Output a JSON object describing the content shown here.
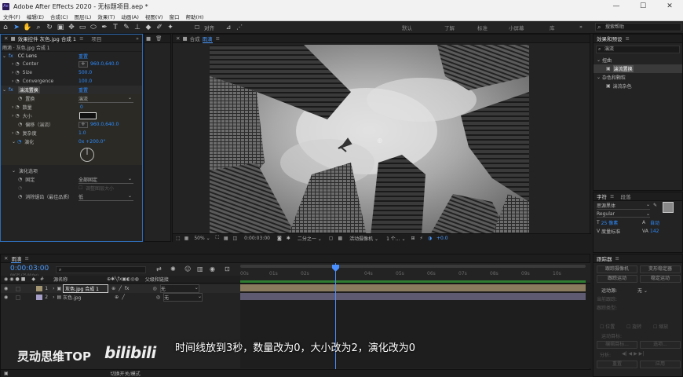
{
  "app": {
    "title": "Adobe After Effects 2020 - 无标题项目.aep *",
    "logo": "Ae"
  },
  "window": {
    "minimize": "—",
    "maximize": "☐",
    "close": "✕"
  },
  "menu": [
    "文件(F)",
    "编辑(E)",
    "合成(C)",
    "图层(L)",
    "效果(T)",
    "动画(A)",
    "视图(V)",
    "窗口",
    "帮助(H)"
  ],
  "toolbar": {
    "align": "对齐",
    "workspaces": [
      "默认",
      "了解",
      "标准",
      "小屏幕",
      "库"
    ],
    "search_placeholder": "搜索帮助"
  },
  "effects_panel": {
    "tab_label": "效果控件 灰色.jpg 合成 1",
    "tab2": "项目",
    "menu_icon": "≡",
    "path": "雨滴 · 灰色.jpg 合成 1",
    "cc_lens": {
      "fx": "fx",
      "name": "CC Lens",
      "reset": "重置",
      "params": [
        {
          "name": "Center",
          "value": "960.0,640.0"
        },
        {
          "name": "Size",
          "value": "500.0"
        },
        {
          "name": "Convergence",
          "value": "100.0"
        }
      ]
    },
    "displace": {
      "fx": "fx",
      "name": "湍流置换",
      "reset": "重置",
      "params": [
        {
          "name": "置换",
          "value": "湍流"
        },
        {
          "name": "数量",
          "value": "0"
        },
        {
          "name": "大小",
          "value": ""
        },
        {
          "name": "偏移（湍流）",
          "value": "960.0,640.0"
        },
        {
          "name": "复杂度",
          "value": "1.0"
        },
        {
          "name": "演化",
          "value": "0x +200.0°"
        }
      ],
      "evo_options": "演化选项",
      "pin": "固定",
      "pin_value": "全部固定",
      "resize": "调整图层大小",
      "antialias": "消除锯齿（最佳品质）",
      "antialias_value": "低"
    }
  },
  "comp": {
    "tab_label": "合成",
    "comp_name": "雨滴",
    "menu_icon": "≡",
    "zoom": "50%",
    "timecode": "0:00:03:00",
    "resolution": "二分之一",
    "camera": "活动摄像机",
    "views": "1 个...",
    "offset": "+0.0"
  },
  "effects_presets": {
    "tab_label": "效果和预设",
    "menu_icon": "≡",
    "search": "湍流",
    "tree": [
      {
        "label": "扭曲",
        "depth": 0
      },
      {
        "label": "湍流置换",
        "depth": 1,
        "selected": true
      },
      {
        "label": "杂色和颗粒",
        "depth": 0
      },
      {
        "label": "湍流杂色",
        "depth": 1
      }
    ]
  },
  "character": {
    "tab_label": "字符",
    "tab2": "段落",
    "menu_icon": "≡",
    "font": "思源黑体",
    "style": "Regular",
    "size": "25 像素",
    "leading": "自动",
    "tracking_label": "度量标准",
    "tracking_value": "142",
    "kerning": "0"
  },
  "tracker": {
    "tab_label": "跟踪器",
    "menu_icon": "≡",
    "buttons": [
      "跟踪摄像机",
      "变形稳定器",
      "跟踪运动",
      "稳定运动"
    ],
    "motion_source_label": "运动源:",
    "motion_source": "无",
    "current_track": "当前跟踪:",
    "track_type": "跟踪类型:",
    "motion_target": "运动目标:",
    "checks": [
      "位置",
      "旋转",
      "缩放"
    ],
    "edit_target": "编辑目标...",
    "options": "选项...",
    "analyze": "分析:",
    "reset": "重置",
    "apply": "应用"
  },
  "timeline": {
    "tab_label": "雨滴",
    "menu_icon": "≡",
    "timecode": "0:00:03:00",
    "frames": "00075 (25.00 fps)",
    "headers": {
      "num": "#",
      "name": "源名称",
      "parent": "父级和链接"
    },
    "layers": [
      {
        "num": "1",
        "name": "灰色.jpg 合成 1",
        "parent": "无"
      },
      {
        "num": "2",
        "name": "灰色.jpg",
        "parent": "无"
      }
    ],
    "ruler": [
      "00s",
      "01s",
      "02s",
      "04s",
      "05s",
      "06s",
      "07s",
      "08s",
      "09s",
      "10s"
    ],
    "footer": "切换开关/模式"
  },
  "subtitle": "时间线放到3秒，数量改为0，大小改为2，演化改为0",
  "watermark": "灵动思维TOP",
  "watermark_logo": "bilibili",
  "colors": {
    "accent": "#2d8cff",
    "layer_bar": "#8a7a5e",
    "label_tan": "#a49672",
    "label_purple": "#a59fc8"
  }
}
